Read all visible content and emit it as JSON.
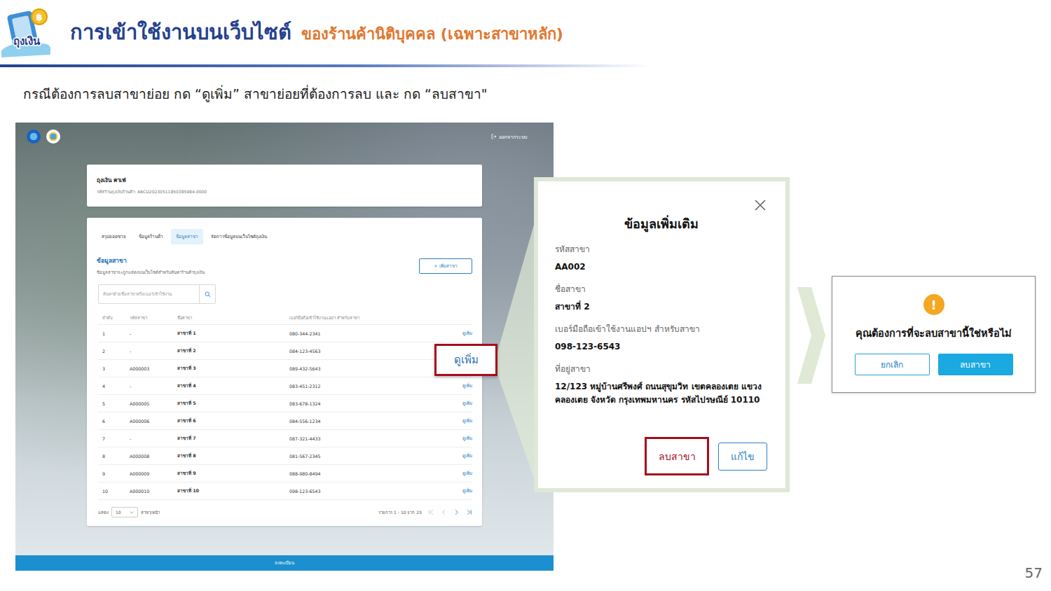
{
  "slide": {
    "logo_text": "ถุงเงิน",
    "coin": "฿",
    "title": "การเข้าใช้งานบนเว็บไซต์",
    "title_highlight": "ของร้านค้านิติบุคคล (เฉพาะสาขาหลัก)",
    "instruction": "กรณีต้องการลบสาขาย่อย กด “ดูเพิ่ม” สาขาย่อยที่ต้องการลบ และ กด “ลบสาขา\"",
    "page_number": "57"
  },
  "app": {
    "logout": "ออกจากระบบ",
    "shop": {
      "name": "ถุงเงิน คาเฟ่",
      "code": "รหัสร้านถุงเงินร้านค้า: ABCD20230511850385984-0000"
    },
    "tabs": [
      {
        "label": "สรุปยอดขาย",
        "selected": false
      },
      {
        "label": "ข้อมูลร้านค้า",
        "selected": false
      },
      {
        "label": "ข้อมูลสาขา",
        "selected": true
      },
      {
        "label": "จัดการข้อมูลบนเว็บไซต์ถุงเงิน",
        "selected": false
      }
    ],
    "branches": {
      "title": "ข้อมูลสาขา",
      "description": "ข้อมูลสาขาจะถูกแสดงบนเว็บไซต์สำหรับค้นหาร้านค้าถุงเงิน",
      "add_button": "+ เพิ่มสาขา",
      "search": {
        "placeholder": "ค้นหาด้วยชื่อสาขาหรือเบอร์เข้าใช้งาน"
      },
      "columns": [
        "ลำดับ",
        "รหัสสาขา",
        "ชื่อสาขา",
        "เบอร์มือถือเข้าใช้งานแอปฯ สำหรับสาขา"
      ],
      "rows": [
        {
          "no": "1",
          "code": "-",
          "name": "สาขาที่ 1",
          "phone": "080-344-2341",
          "action": "ดูเพิ่ม"
        },
        {
          "no": "2",
          "code": "-",
          "name": "สาขาที่ 2",
          "phone": "084-123-4563",
          "action": ""
        },
        {
          "no": "3",
          "code": "A000003",
          "name": "สาขาที่ 3",
          "phone": "089-432-5643",
          "action": "ดูเพิ่ม"
        },
        {
          "no": "4",
          "code": "-",
          "name": "สาขาที่ 4",
          "phone": "083-451-2312",
          "action": "ดูเพิ่ม"
        },
        {
          "no": "5",
          "code": "A000005",
          "name": "สาขาที่ 5",
          "phone": "083-678-1324",
          "action": "ดูเพิ่ม"
        },
        {
          "no": "6",
          "code": "A000006",
          "name": "สาขาที่ 6",
          "phone": "084-556-1234",
          "action": "ดูเพิ่ม"
        },
        {
          "no": "7",
          "code": "-",
          "name": "สาขาที่ 7",
          "phone": "087-321-4433",
          "action": "ดูเพิ่ม"
        },
        {
          "no": "8",
          "code": "A000008",
          "name": "สาขาที่ 8",
          "phone": "081-567-2345",
          "action": "ดูเพิ่ม"
        },
        {
          "no": "9",
          "code": "A000009",
          "name": "สาขาที่ 9",
          "phone": "088-980-8494",
          "action": "ดูเพิ่ม"
        },
        {
          "no": "10",
          "code": "A000010",
          "name": "สาขาที่ 10",
          "phone": "098-123-6543",
          "action": "ดูเพิ่ม"
        }
      ],
      "page_size_label": "แสดง",
      "page_size": "10",
      "page_size_unit": "สาขา/หน้า",
      "range": "รายการ 1 - 10 จาก 25",
      "pager": [
        {
          "kind": "first",
          "disabled": true
        },
        {
          "kind": "prev",
          "disabled": true
        },
        {
          "kind": "next",
          "disabled": false
        },
        {
          "kind": "last",
          "disabled": false
        }
      ]
    },
    "footer": "ลงทะเบียน"
  },
  "callout": {
    "label": "ดูเพิ่ม"
  },
  "detail_modal": {
    "title": "ข้อมูลเพิ่มเติม",
    "fields": [
      {
        "label": "รหัสสาขา",
        "value": "AA002"
      },
      {
        "label": "ชื่อสาขา",
        "value": "สาขาที่ 2"
      },
      {
        "label": "เบอร์มือถือเข้าใช้งานแอปฯ สำหรับสาขา",
        "value": "098-123-6543"
      },
      {
        "label": "ที่อยู่สาขา",
        "value": "12/123 หมู่บ้านศรีพงศ์ ถนนสุขุมวิท เขตคลองเตย แขวงคลองเตย จังหวัด กรุงเทพมหานคร รหัสไปรษณีย์ 10110"
      }
    ],
    "buttons": [
      {
        "label": "ลบสาขา",
        "highlighted": true
      },
      {
        "label": "แก้ไข",
        "highlighted": false
      }
    ]
  },
  "confirm_dialog": {
    "icon": "!",
    "message": "คุณต้องการที่จะลบสาขานี้ใช่หรือไม่",
    "buttons": [
      {
        "label": "ยกเลิก",
        "primary": false
      },
      {
        "label": "ลบสาขา",
        "primary": true
      }
    ]
  }
}
